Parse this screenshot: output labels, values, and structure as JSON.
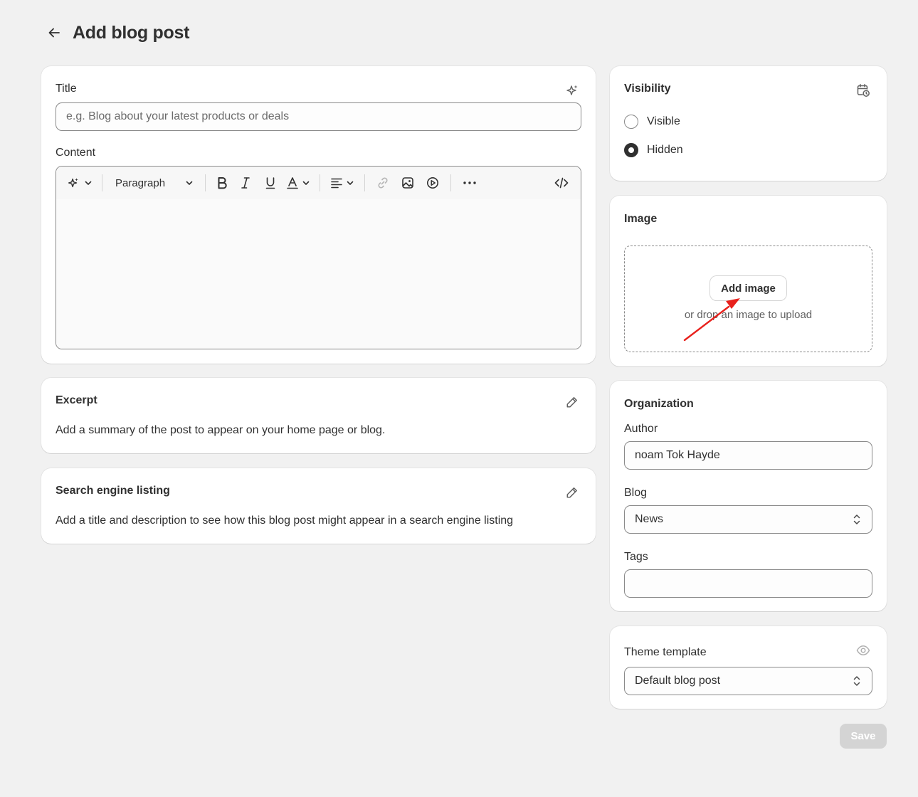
{
  "header": {
    "title": "Add blog post"
  },
  "main": {
    "title_label": "Title",
    "title_placeholder": "e.g. Blog about your latest products or deals",
    "content_label": "Content",
    "toolbar": {
      "paragraph_label": "Paragraph"
    }
  },
  "excerpt": {
    "title": "Excerpt",
    "description": "Add a summary of the post to appear on your home page or blog."
  },
  "seo": {
    "title": "Search engine listing",
    "description": "Add a title and description to see how this blog post might appear in a search engine listing"
  },
  "visibility": {
    "title": "Visibility",
    "options": [
      {
        "label": "Visible",
        "checked": false
      },
      {
        "label": "Hidden",
        "checked": true
      }
    ]
  },
  "image": {
    "title": "Image",
    "button_label": "Add image",
    "hint": "or drop an image to upload"
  },
  "organization": {
    "title": "Organization",
    "author_label": "Author",
    "author_value": "noam Tok Hayde",
    "blog_label": "Blog",
    "blog_value": "News",
    "tags_label": "Tags",
    "tags_value": ""
  },
  "theme": {
    "title": "Theme template",
    "value": "Default blog post"
  },
  "footer": {
    "save_label": "Save"
  },
  "colors": {
    "accent": "#303030",
    "annotation_arrow": "#e8211c",
    "disabled_button": "#d4d4d4"
  }
}
